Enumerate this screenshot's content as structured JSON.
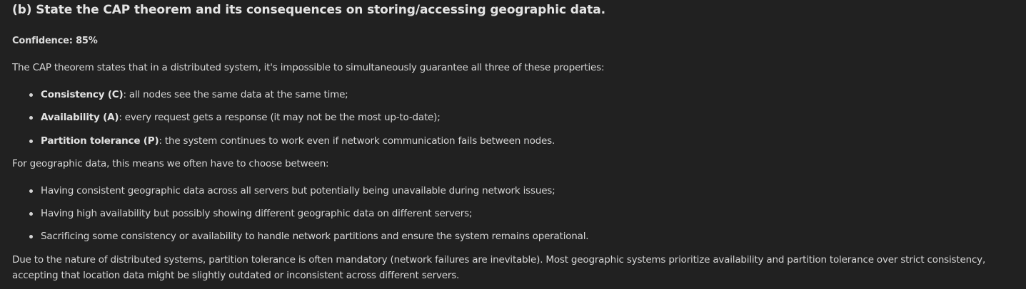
{
  "heading": "(b) State the CAP theorem and its consequences on storing/accessing geographic data.",
  "confidence": "Confidence: 85%",
  "intro": "The CAP theorem states that in a distributed system, it's impossible to simultaneously guarantee all three of these properties:",
  "cap_properties": [
    {
      "term": "Consistency (C)",
      "desc": ": all nodes see the same data at the same time;"
    },
    {
      "term": "Availability (A)",
      "desc": ": every request gets a response (it may not be the most up-to-date);"
    },
    {
      "term": "Partition tolerance (P)",
      "desc": ": the system continues to work even if network communication fails between nodes."
    }
  ],
  "geo_intro": "For geographic data, this means we often have to choose between:",
  "geo_options": [
    "Having consistent geographic data across all servers but potentially being unavailable during network issues;",
    "Having high availability but possibly showing different geographic data on different servers;",
    "Sacrificing some consistency or availability to handle network partitions and ensure the system remains operational."
  ],
  "conclusion": "Due to the nature of distributed systems, partition tolerance is often mandatory (network failures are inevitable). Most geographic systems prioritize availability and partition tolerance over strict consistency, accepting that location data might be slightly outdated or inconsistent across different servers."
}
